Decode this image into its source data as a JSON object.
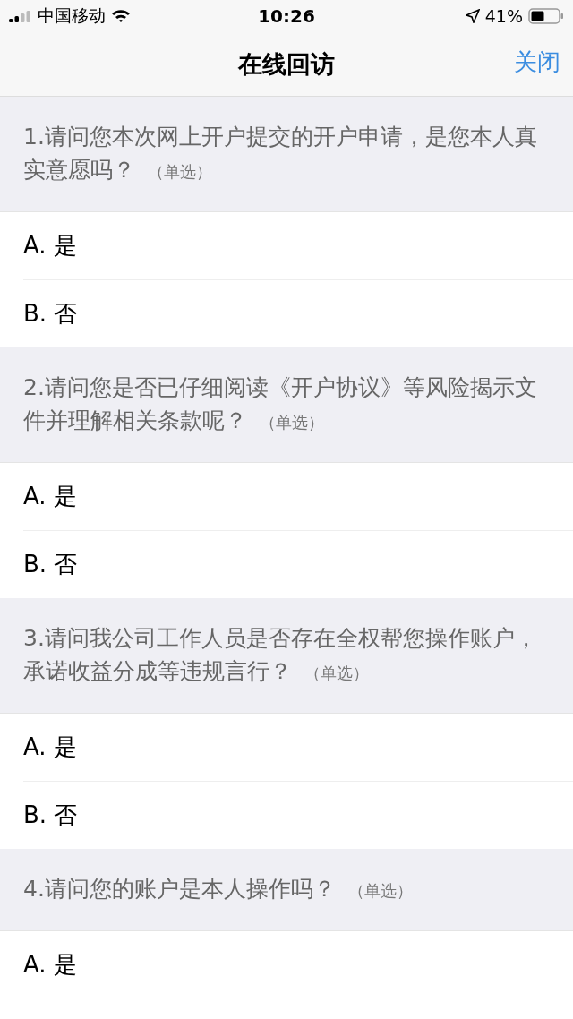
{
  "status_bar": {
    "carrier": "中国移动",
    "time": "10:26",
    "battery": "41%"
  },
  "nav": {
    "title": "在线回访",
    "close": "关闭"
  },
  "questions": [
    {
      "text": "1.请问您本次网上开户提交的开户申请，是您本人真实意愿吗？",
      "type": "（单选）",
      "options": [
        "A. 是",
        "B. 否"
      ]
    },
    {
      "text": "2.请问您是否已仔细阅读《开户协议》等风险揭示文件并理解相关条款呢？",
      "type": "（单选）",
      "options": [
        "A. 是",
        "B. 否"
      ]
    },
    {
      "text": "3.请问我公司工作人员是否存在全权帮您操作账户，承诺收益分成等违规言行？",
      "type": "（单选）",
      "options": [
        "A. 是",
        "B. 否"
      ]
    },
    {
      "text": "4.请问您的账户是本人操作吗？",
      "type": "（单选）",
      "options": [
        "A. 是"
      ]
    }
  ]
}
